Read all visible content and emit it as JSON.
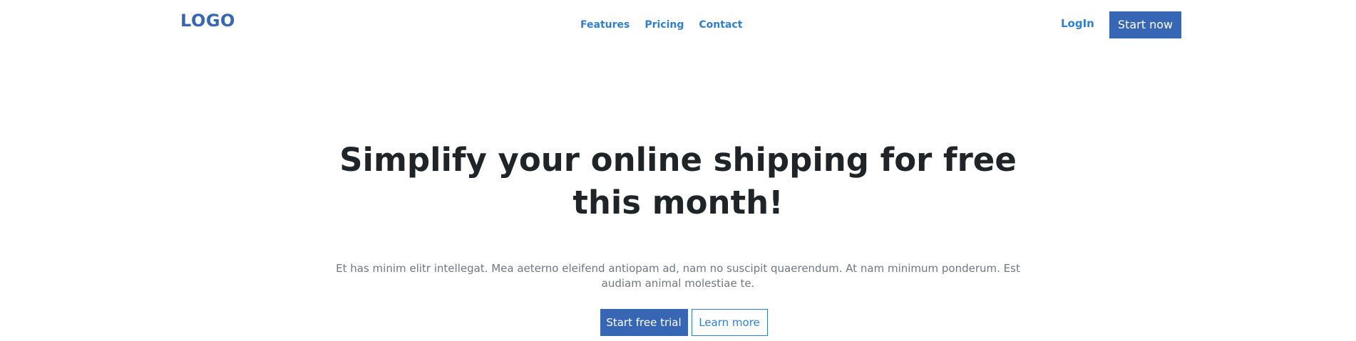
{
  "header": {
    "logo": "LOGO",
    "nav": [
      {
        "label": "Features"
      },
      {
        "label": "Pricing"
      },
      {
        "label": "Contact"
      }
    ],
    "login_label": "LogIn",
    "start_now_label": "Start now"
  },
  "hero": {
    "title": "Simplify your online shipping for free this month!",
    "description": "Et has minim elitr intellegat. Mea aeterno eleifend antiopam ad, nam no suscipit quaerendum. At nam minimum ponderum. Est audiam animal molestiae te.",
    "primary_cta": "Start free trial",
    "secondary_cta": "Learn more"
  },
  "colors": {
    "brand": "#3766b5",
    "link": "#2f7fd1",
    "heading": "#1f2428",
    "body_text": "#6f777f"
  }
}
